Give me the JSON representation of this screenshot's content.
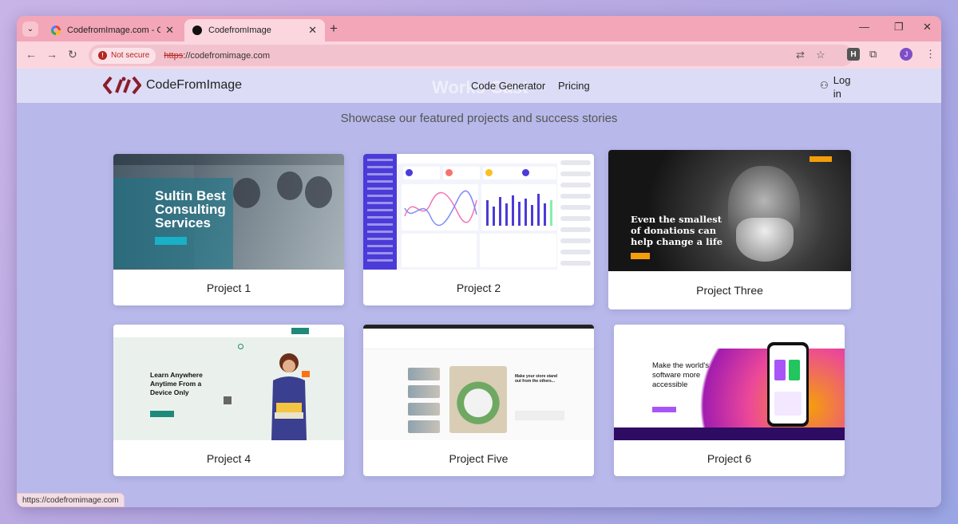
{
  "browser": {
    "tabs": [
      {
        "title": "CodefromImage.com - Google S",
        "active": false,
        "favicon": "google-icon"
      },
      {
        "title": "CodefromImage",
        "active": true,
        "favicon": "site-dot-icon"
      }
    ],
    "address": {
      "security_label": "Not secure",
      "url_scheme": "https",
      "url_rest": "://codefromimage.com"
    },
    "profile_initial": "J",
    "extension_label": "H",
    "status_url": "https://codefromimage.com"
  },
  "site": {
    "brand": "CodeFromImage",
    "ghost_title": "Works Cast",
    "nav": [
      "Code Generator",
      "Pricing"
    ],
    "login_label": "Log in",
    "subtitle": "Showcase our featured projects and success stories"
  },
  "projects": [
    {
      "title": "Project 1",
      "hero_text": "Sultin Best Consulting Services"
    },
    {
      "title": "Project 2",
      "hero_text": "Dashboard"
    },
    {
      "title": "Project Three",
      "hero_text": "Even the smallest of donations can help change a life ..."
    },
    {
      "title": "Project 4",
      "hero_text": "Learn Anywhere Anytime From a Device Only"
    },
    {
      "title": "Project Five",
      "hero_text": "Make your store stand out from the others..."
    },
    {
      "title": "Project 6",
      "hero_text": "Make the world's software more accessible"
    }
  ],
  "colors": {
    "accent_tab": "#f3a6b8",
    "page_bg": "#b8b8ea",
    "header_bg": "#dcdcf6",
    "logo_red": "#8b1c2b"
  }
}
